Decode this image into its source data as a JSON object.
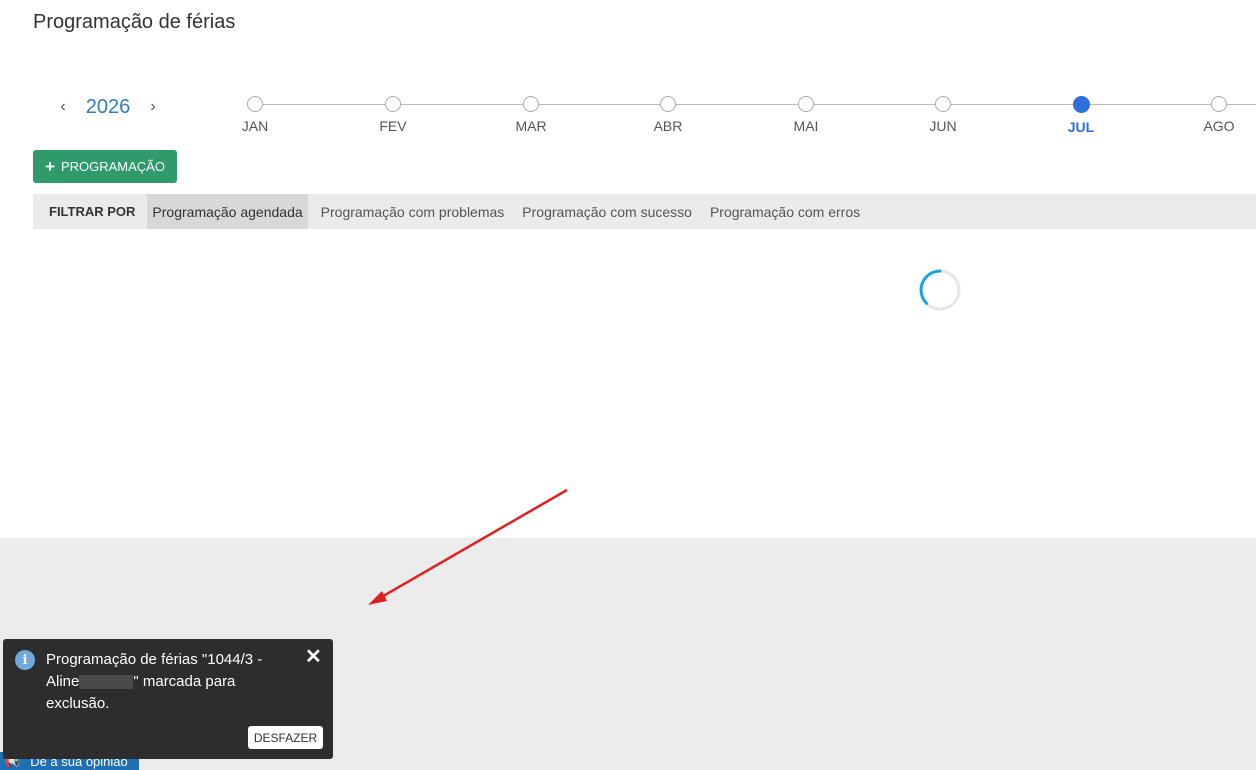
{
  "page": {
    "title": "Programação de férias"
  },
  "year_nav": {
    "prev": "‹",
    "year": "2026",
    "next": "›"
  },
  "timeline": {
    "months": [
      "JAN",
      "FEV",
      "MAR",
      "ABR",
      "MAI",
      "JUN",
      "JUL",
      "AGO"
    ],
    "selected": "JUL",
    "accent": "#2f6fdc"
  },
  "toolbar": {
    "add_label": "PROGRAMAÇÃO",
    "add_color": "#2f9a6a"
  },
  "filters": {
    "label": "FILTRAR POR",
    "tabs": [
      "Programação agendada",
      "Programação com problemas",
      "Programação com sucesso",
      "Programação com erros"
    ],
    "active": "Programação agendada"
  },
  "toast": {
    "line1": "Programação de férias \"1044/3 -",
    "line2_start": "Aline",
    "line2_end": "\" marcada para",
    "line3": "exclusão.",
    "close": "✕",
    "undo_label": "DESFAZER"
  },
  "feedback": {
    "label": "Dê a sua opinião"
  }
}
